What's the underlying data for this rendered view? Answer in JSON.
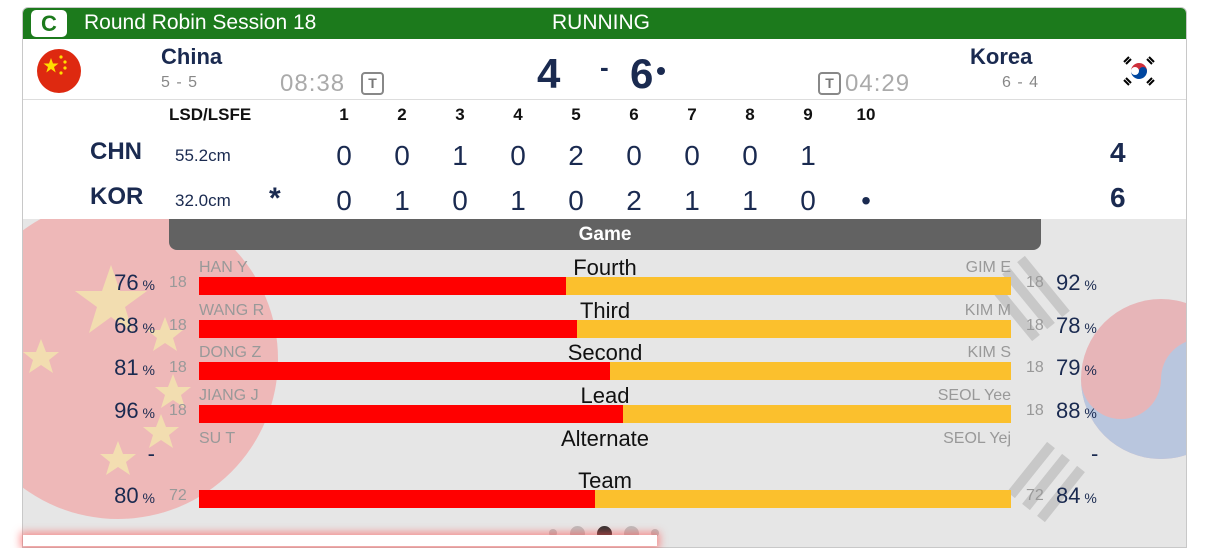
{
  "header": {
    "badge": "C",
    "session": "Round Robin Session 18",
    "status": "RUNNING"
  },
  "home": {
    "name": "China",
    "record": "5 - 5",
    "clock": "08:38",
    "timeout": "T",
    "score": "4",
    "code": "CHN",
    "lsd": "55.2cm",
    "total": "4"
  },
  "away": {
    "name": "Korea",
    "record": "6 - 4",
    "clock": "04:29",
    "timeout": "T",
    "score": "6",
    "code": "KOR",
    "lsd": "32.0cm",
    "total": "6",
    "hammer_mark": "*"
  },
  "score_separator": "-",
  "linescore": {
    "lsd_label": "LSD/LSFE",
    "ends": [
      "1",
      "2",
      "3",
      "4",
      "5",
      "6",
      "7",
      "8",
      "9",
      "10"
    ],
    "chn": [
      "0",
      "0",
      "1",
      "0",
      "2",
      "0",
      "0",
      "0",
      "1",
      ""
    ],
    "kor": [
      "0",
      "1",
      "0",
      "1",
      "0",
      "2",
      "1",
      "1",
      "0",
      "•"
    ]
  },
  "game": {
    "title": "Game",
    "positions": [
      {
        "position": "Fourth",
        "home_player": "HAN Y",
        "home_pct": "76",
        "home_shots": "18",
        "away_player": "GIM E",
        "away_pct": "92",
        "away_shots": "18",
        "home_share": 0.452
      },
      {
        "position": "Third",
        "home_player": "WANG R",
        "home_pct": "68",
        "home_shots": "18",
        "away_player": "KIM M",
        "away_pct": "78",
        "away_shots": "18",
        "home_share": 0.466
      },
      {
        "position": "Second",
        "home_player": "DONG Z",
        "home_pct": "81",
        "home_shots": "18",
        "away_player": "KIM S",
        "away_pct": "79",
        "away_shots": "18",
        "home_share": 0.506
      },
      {
        "position": "Lead",
        "home_player": "JIANG J",
        "home_pct": "96",
        "home_shots": "18",
        "away_player": "SEOL Yee",
        "away_pct": "88",
        "away_shots": "18",
        "home_share": 0.522
      },
      {
        "position": "Alternate",
        "home_player": "SU T",
        "home_pct": "-",
        "home_shots": "",
        "away_player": "SEOL Yej",
        "away_pct": "-",
        "away_shots": "",
        "home_share": null
      },
      {
        "position": "Team",
        "home_player": "",
        "home_pct": "80",
        "home_shots": "72",
        "away_player": "",
        "away_pct": "84",
        "away_shots": "72",
        "home_share": 0.488
      }
    ],
    "percent_sign": "%"
  },
  "carousel": {
    "pages": 5,
    "active": 2
  },
  "colors": {
    "title_bar": "#1c7a1c",
    "home_bar": "#ff0000",
    "away_bar": "#fbc02d",
    "team_text": "#1a2a50"
  },
  "icons": {
    "home_flag": "china-flag-icon",
    "away_flag": "korea-flag-icon",
    "timeout": "timeout-icon"
  }
}
